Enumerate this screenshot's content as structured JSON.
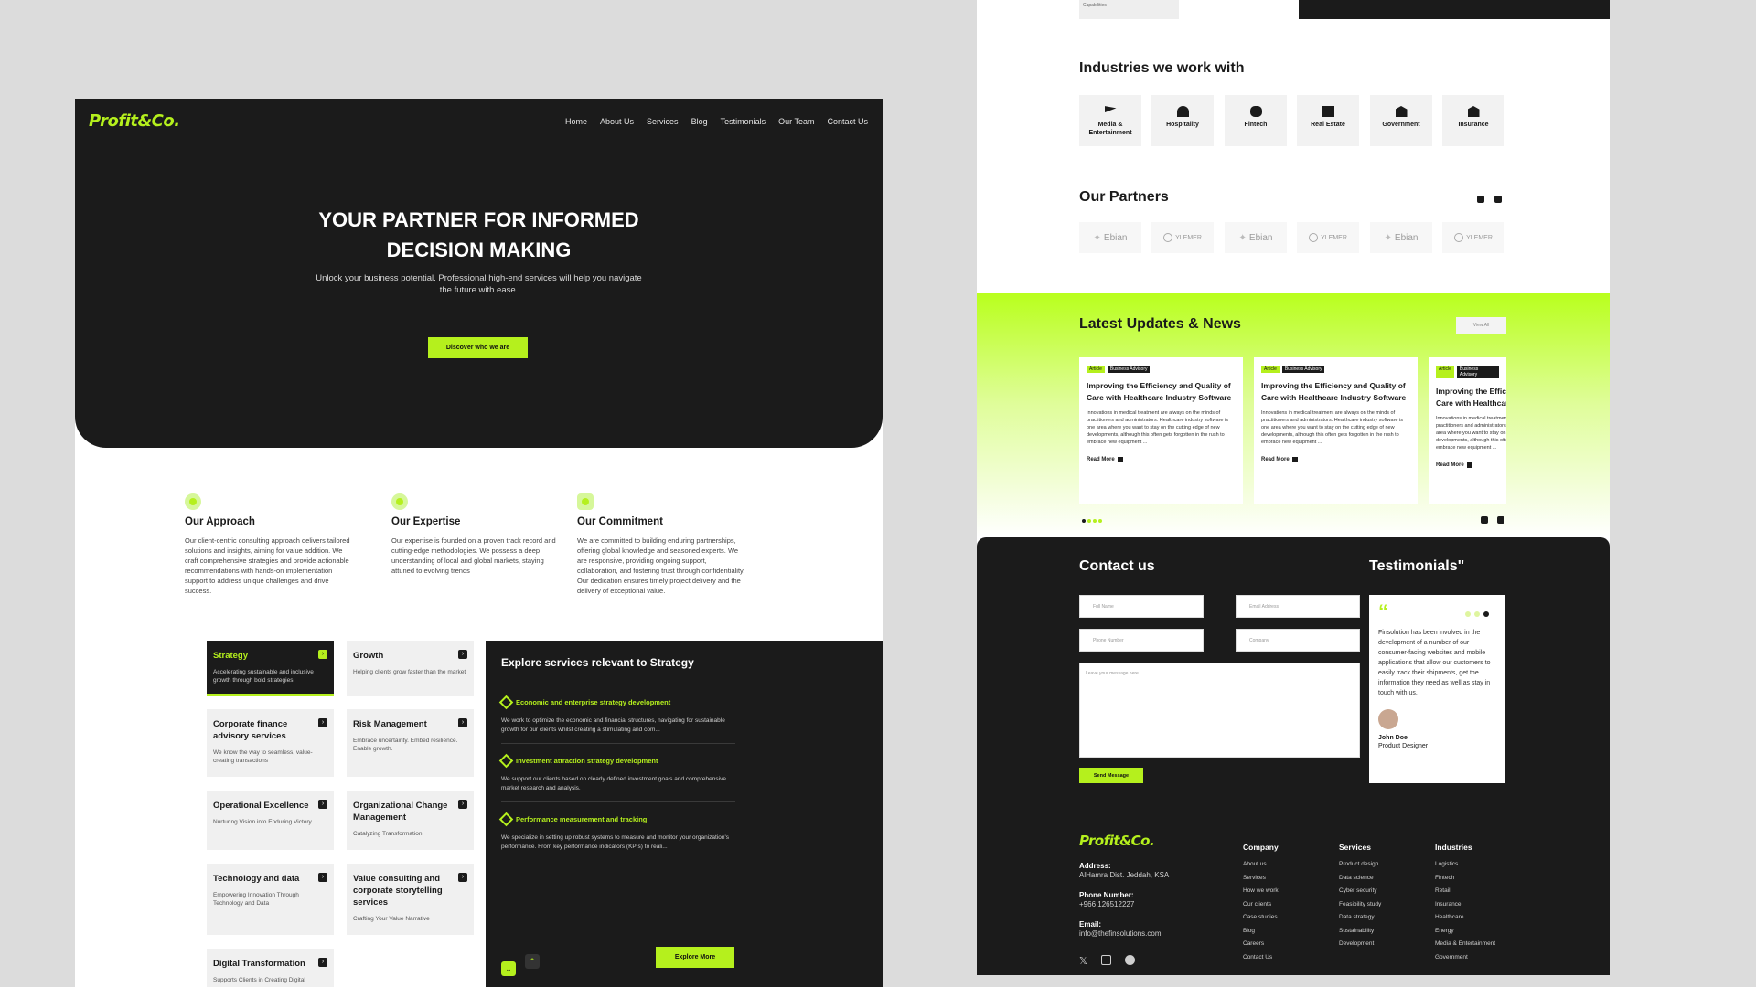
{
  "brand": "Profit&Co.",
  "colors": {
    "accent": "#b5f01d",
    "dark": "#1b1b1b",
    "backdrop": "#dcdcdc"
  },
  "nav": [
    "Home",
    "About Us",
    "Services",
    "Blog",
    "Testimonials",
    "Our Team",
    "Contact Us"
  ],
  "hero": {
    "title_line1": "YOUR PARTNER FOR INFORMED",
    "title_line2": "DECISION MAKING",
    "subtitle": "Unlock your business potential. Professional high-end services will help you navigate the future with ease.",
    "cta": "Discover who we are"
  },
  "features": [
    {
      "title": "Our Approach",
      "text": "Our client-centric consulting approach delivers tailored solutions and insights, aiming for value addition. We craft comprehensive strategies and provide actionable recommendations with hands-on implementation support to address unique challenges and drive success."
    },
    {
      "title": "Our Expertise",
      "text": "Our expertise is founded on a proven track record and cutting-edge methodologies. We possess a deep understanding of local and global markets, staying attuned to evolving trends"
    },
    {
      "title": "Our Commitment",
      "text": "We are committed to building enduring partnerships, offering global knowledge and seasoned experts. We are responsive, providing ongoing support, collaboration, and fostering trust through confidentiality. Our dedication ensures timely project delivery and the delivery of exceptional value."
    }
  ],
  "services": [
    {
      "title": "Strategy",
      "text": "Accelerating sustainable and inclusive growth through bold strategies"
    },
    {
      "title": "Growth",
      "text": "Helping clients grow faster than the market"
    },
    {
      "title": "Corporate finance advisory services",
      "text": "We know the way to seamless, value-creating transactions"
    },
    {
      "title": "Risk Management",
      "text": "Embrace uncertainty. Embed resilience. Enable growth."
    },
    {
      "title": "Operational Excellence",
      "text": "Nurturing Vision into Enduring Victory"
    },
    {
      "title": "Organizational Change Management",
      "text": "Catalyzing Transformation"
    },
    {
      "title": "Technology and data",
      "text": "Empowering Innovation Through Technology and Data"
    },
    {
      "title": "Value consulting and corporate storytelling services",
      "text": "Crafting Your Value Narrative"
    },
    {
      "title": "Digital Transformation",
      "text": "Supports Clients in Creating Digital"
    }
  ],
  "explore": {
    "title": "Explore services relevant to Strategy",
    "items": [
      {
        "title": "Economic and enterprise strategy development",
        "text": "We work to optimize the economic and financial structures, navigating for sustainable growth for our clients whilst creating a stimulating and com..."
      },
      {
        "title": "Investment attraction strategy development",
        "text": "We support our clients based on clearly defined investment goals and comprehensive market research and analysis."
      },
      {
        "title": "Performance measurement and tracking",
        "text": "We specialize in setting up robust systems to measure and monitor your organization's performance. From key performance indicators (KPIs) to reali..."
      }
    ],
    "cta": "Explore More"
  },
  "right_top_fragment": "Capabilities",
  "industries": {
    "title": "Industries we work with",
    "items": [
      "Media & Entertainment",
      "Hospitality",
      "Fintech",
      "Real Estate",
      "Government",
      "Insurance"
    ]
  },
  "partners": {
    "title": "Our Partners",
    "items": [
      "Ebian",
      "YLEMER",
      "Ebian",
      "YLEMER",
      "Ebian",
      "YLEMER"
    ]
  },
  "news": {
    "title": "Latest Updates & News",
    "view_all": "View All",
    "tag1": "Article",
    "tag2": "Business Advisory",
    "card_title": "Improving the Efficiency and Quality of Care with Healthcare Industry Software",
    "card_text": "Innovations in medical treatment are always on the minds of practitioners and administrators. Healthcare industry software is one area where you want to stay on the cutting edge of new developments, although this often gets forgotten in the rush to embrace new equipment ...",
    "read_more": "Read More"
  },
  "contact": {
    "title": "Contact us",
    "full_name": "Full Name",
    "email": "Email Address",
    "phone": "Phone Number",
    "company": "Company",
    "message": "Leave your message here",
    "send": "Send Message"
  },
  "testimonials": {
    "title": "Testimonials\"",
    "quote_mark": "“",
    "text": "Finsolution has been involved in the development of a number of our consumer-facing websites and mobile applications that allow our customers to easily track their shipments, get the information they need as well as stay in touch with us.",
    "name": "John Doe",
    "role": "Product Designer"
  },
  "footer": {
    "address_label": "Address:",
    "address": "AlHamra Dist. Jeddah, KSA",
    "phone_label": "Phone Number:",
    "phone": "+966 126512227",
    "email_label": "Email:",
    "email": "info@thefinsolutions.com",
    "company": {
      "title": "Company",
      "links": [
        "About us",
        "Services",
        "How we work",
        "Our clients",
        "Case studies",
        "Blog",
        "Careers",
        "Contact Us"
      ]
    },
    "services": {
      "title": "Services",
      "links": [
        "Product design",
        "Data science",
        "Cyber security",
        "Feasibility study",
        "Data strategy",
        "Sustainability",
        "Development"
      ]
    },
    "industries": {
      "title": "Industries",
      "links": [
        "Logistics",
        "Fintech",
        "Retail",
        "Insurance",
        "Healthcare",
        "Energy",
        "Media & Entertainment",
        "Government"
      ]
    },
    "social_icons": [
      "x-icon",
      "linkedin-icon",
      "facebook-icon"
    ]
  }
}
